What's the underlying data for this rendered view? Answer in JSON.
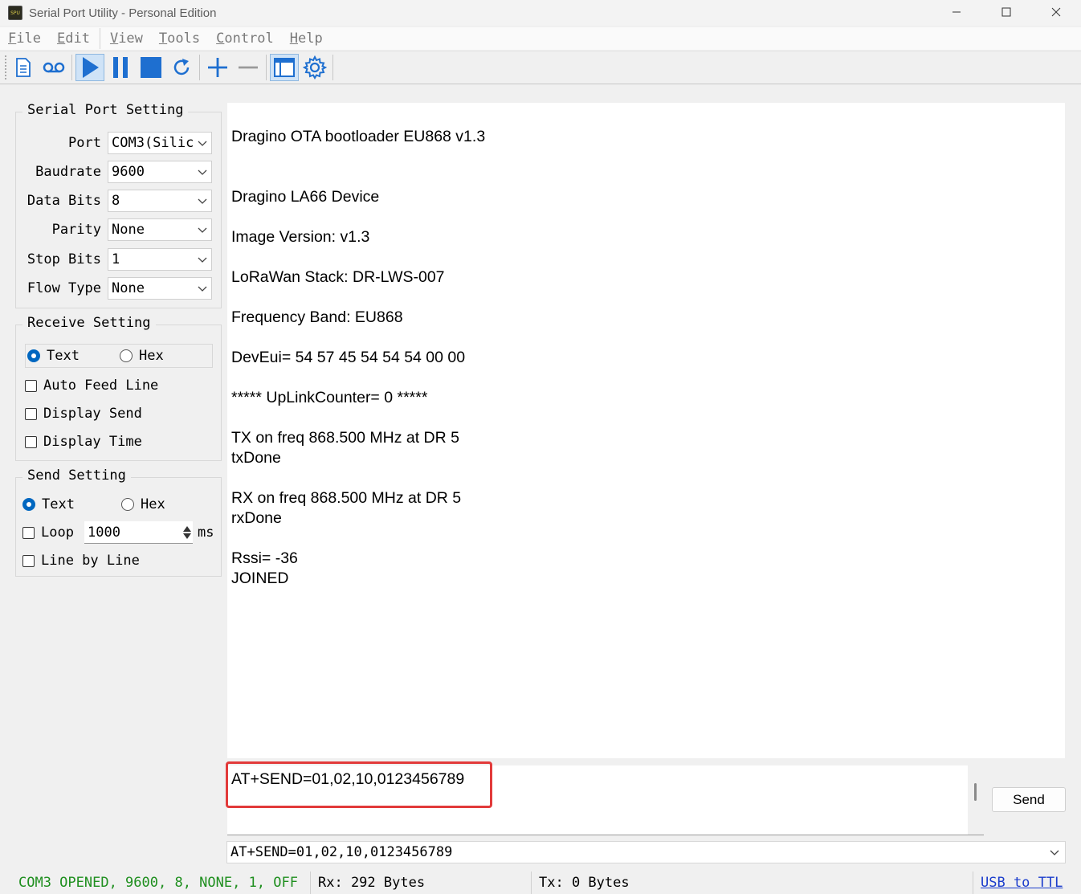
{
  "window": {
    "title": "Serial Port Utility - Personal Edition",
    "icon_text": "SPU",
    "controls": [
      "minimize-icon",
      "maximize-icon",
      "close-icon"
    ]
  },
  "menu": {
    "items": [
      {
        "label": "File",
        "accel": "F",
        "rest": "ile"
      },
      {
        "label": "Edit",
        "accel": "E",
        "rest": "dit"
      },
      {
        "label": "View",
        "accel": "V",
        "rest": "iew"
      },
      {
        "label": "Tools",
        "accel": "T",
        "rest": "ools"
      },
      {
        "label": "Control",
        "accel": "C",
        "rest": "ontrol"
      },
      {
        "label": "Help",
        "accel": "H",
        "rest": "elp"
      }
    ]
  },
  "toolbar": {
    "icons": [
      "new-document-icon",
      "record-icon",
      "play-icon",
      "pause-icon",
      "stop-icon",
      "refresh-icon",
      "add-icon",
      "remove-icon",
      "window-layout-icon",
      "settings-gear-icon"
    ],
    "active": "play-icon",
    "accent_color": "#1e6fd0"
  },
  "serial_port_setting": {
    "title": "Serial Port Setting",
    "fields": [
      {
        "label": "Port",
        "value": "COM3(Silic"
      },
      {
        "label": "Baudrate",
        "value": "9600"
      },
      {
        "label": "Data Bits",
        "value": "8"
      },
      {
        "label": "Parity",
        "value": "None"
      },
      {
        "label": "Stop Bits",
        "value": "1"
      },
      {
        "label": "Flow Type",
        "value": "None"
      }
    ]
  },
  "receive_setting": {
    "title": "Receive Setting",
    "mode_text": "Text",
    "mode_hex": "Hex",
    "selected": "Text",
    "auto_feed_line": "Auto Feed Line",
    "display_send": "Display Send",
    "display_time": "Display Time"
  },
  "send_setting": {
    "title": "Send Setting",
    "mode_text": "Text",
    "mode_hex": "Hex",
    "selected": "Text",
    "loop": "Loop",
    "loop_interval": "1000",
    "loop_unit": "ms",
    "line_by_line": "Line by Line"
  },
  "receive_output": "Dragino OTA bootloader EU868 v1.3\n\n\nDragino LA66 Device\n\nImage Version: v1.3\n\nLoRaWan Stack: DR-LWS-007\n\nFrequency Band: EU868\n\nDevEui= 54 57 45 54 54 54 00 00\n\n***** UpLinkCounter= 0 *****\n\nTX on freq 868.500 MHz at DR 5\ntxDone\n\nRX on freq 868.500 MHz at DR 5\nrxDone\n\nRssi= -36\nJOINED",
  "send_input": {
    "value": "AT+SEND=01,02,10,0123456789",
    "button_label": "Send",
    "highlight_color": "#e23a3a"
  },
  "history": {
    "selected": "AT+SEND=01,02,10,0123456789"
  },
  "status": {
    "connection": "COM3 OPENED, 9600, 8, NONE, 1, OFF",
    "rx": "Rx: 292 Bytes",
    "tx": "Tx: 0 Bytes",
    "link": "USB to TTL",
    "connection_color": "#1f8f1f"
  }
}
